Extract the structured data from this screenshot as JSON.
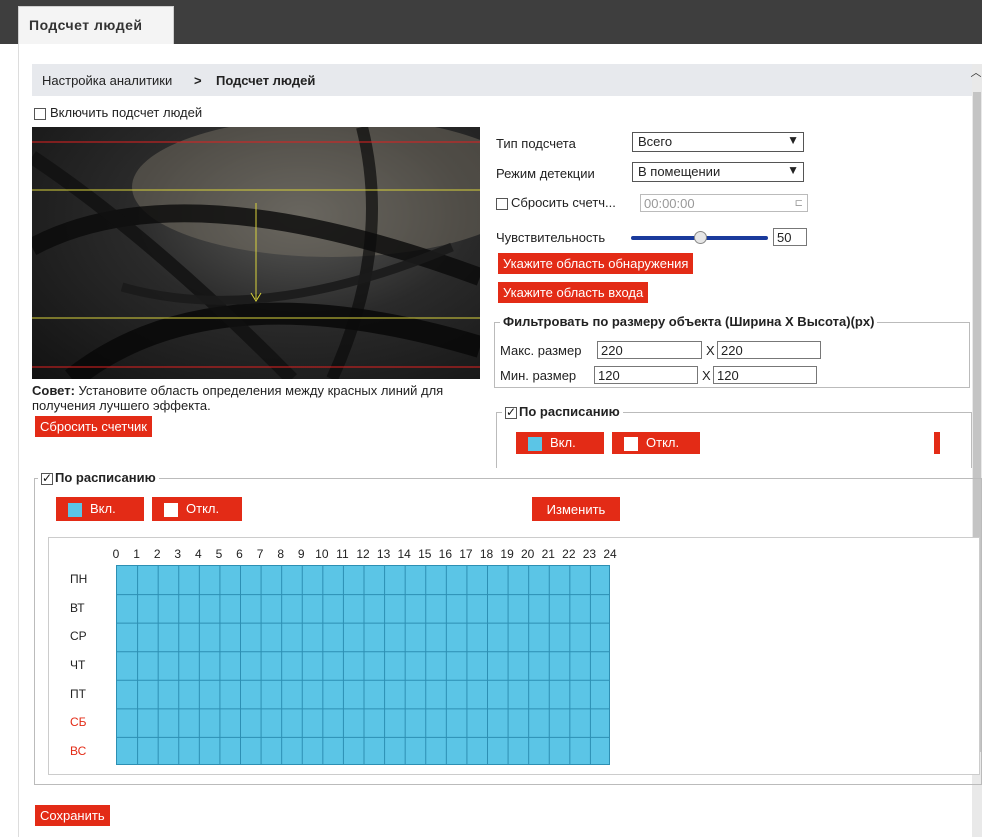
{
  "tab": {
    "label": "Подсчет людей"
  },
  "breadcrumb": {
    "parent": "Настройка аналитики",
    "separator": ">",
    "current": "Подсчет людей"
  },
  "enable": {
    "label": "Включить подсчет людей",
    "checked": false
  },
  "tip": {
    "bold": "Совет:",
    "text": " Установите область определения между красных линий для получения лучшего эффекта."
  },
  "reset_counter_button": "Сбросить счетчик",
  "settings": {
    "count_type_label": "Тип подсчета",
    "count_type_value": "Всего",
    "detection_mode_label": "Режим детекции",
    "detection_mode_value": "В помещении",
    "reset_count_label": "Сбросить счетч...",
    "reset_count_checked": false,
    "reset_time_value": "00:00:00",
    "sensitivity_label": "Чувствительность",
    "sensitivity_value": "50",
    "sensitivity_fraction": 0.5,
    "detect_area_button": "Укажите область обнаружения",
    "entry_area_button": "Укажите область входа"
  },
  "size_filter": {
    "legend": "Фильтровать по размеру объекта (Ширина X Высота)(px)",
    "max_label": "Макс. размер",
    "max_width": "220",
    "max_height": "220",
    "min_label": "Мин. размер",
    "min_width": "120",
    "min_height": "120",
    "x_sep": "X"
  },
  "inner_schedule": {
    "legend": "По расписанию",
    "checked": true,
    "on_label": "Вкл.",
    "off_label": "Откл."
  },
  "schedule": {
    "legend": "По расписанию",
    "checked": true,
    "on_label": "Вкл.",
    "off_label": "Откл.",
    "edit_button": "Изменить",
    "hours": [
      "0",
      "1",
      "2",
      "3",
      "4",
      "5",
      "6",
      "7",
      "8",
      "9",
      "10",
      "11",
      "12",
      "13",
      "14",
      "15",
      "16",
      "17",
      "18",
      "19",
      "20",
      "21",
      "22",
      "23",
      "24"
    ],
    "days": [
      {
        "label": "ПН",
        "weekend": false
      },
      {
        "label": "ВТ",
        "weekend": false
      },
      {
        "label": "СР",
        "weekend": false
      },
      {
        "label": "ЧТ",
        "weekend": false
      },
      {
        "label": "ПТ",
        "weekend": false
      },
      {
        "label": "СБ",
        "weekend": true
      },
      {
        "label": "ВС",
        "weekend": true
      }
    ]
  },
  "save_button": "Сохранить",
  "colors": {
    "accent": "#e32b16",
    "schedule_on": "#5bc5e6",
    "tab_bar": "#3e3e3e",
    "breadcrumb_bg": "#e7e9ed"
  }
}
